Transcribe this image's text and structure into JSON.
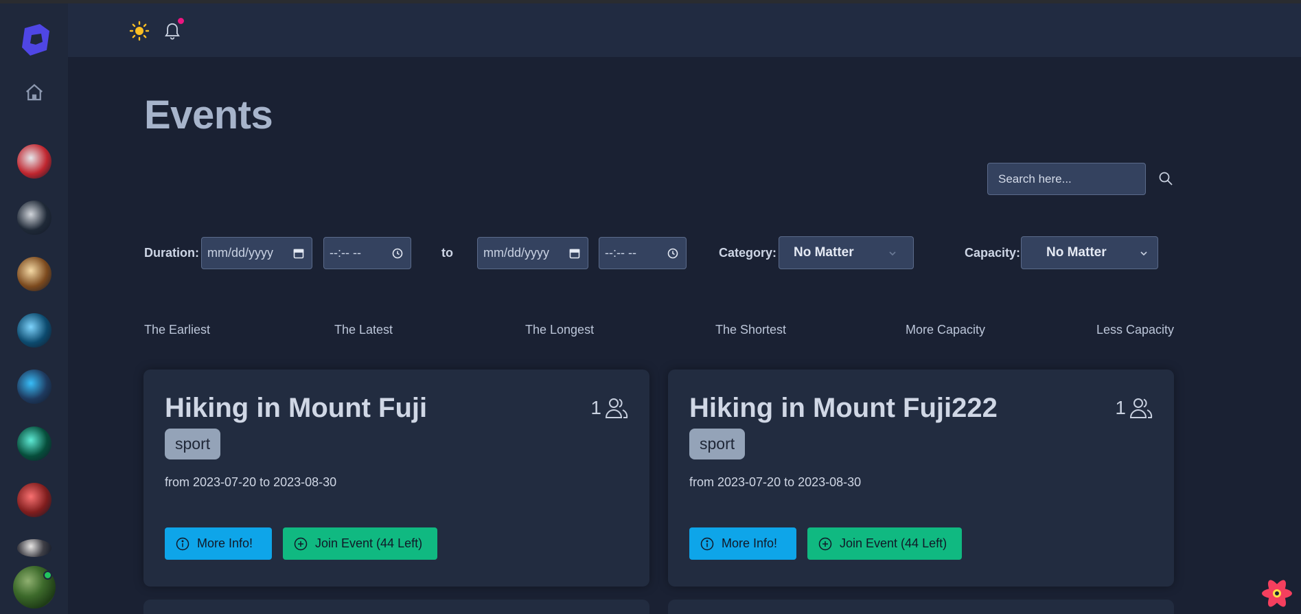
{
  "header": {
    "theme_icon": "sun-icon",
    "notification_icon": "bell-icon",
    "notification_color": "#ec1680"
  },
  "sidebar": {
    "logo_color": "#4f46e5",
    "home_icon": "home-icon",
    "avatars": [
      {
        "name": "avatar-1",
        "colors": [
          "#c0262f",
          "#e5e7eb"
        ]
      },
      {
        "name": "avatar-2",
        "colors": [
          "#1f2937",
          "#d1d5db"
        ]
      },
      {
        "name": "avatar-3",
        "colors": [
          "#7c4a1e",
          "#f4d9a5"
        ]
      },
      {
        "name": "avatar-4",
        "colors": [
          "#0c4a6e",
          "#7dd3fc"
        ]
      },
      {
        "name": "avatar-5",
        "colors": [
          "#1e3a5f",
          "#38bdf8"
        ]
      },
      {
        "name": "avatar-6",
        "colors": [
          "#064e3b",
          "#5eead4"
        ]
      },
      {
        "name": "avatar-7",
        "colors": [
          "#7f1d1d",
          "#f87171"
        ]
      },
      {
        "name": "avatar-8",
        "colors": [
          "#3f3f46",
          "#e7e5e4"
        ]
      }
    ],
    "user_status_color": "#22c55e"
  },
  "page": {
    "title": "Events"
  },
  "search": {
    "placeholder": "Search here..."
  },
  "filters": {
    "duration_label": "Duration:",
    "date_placeholder": "mm/dd/yyyy",
    "time_placeholder": "--:-- --",
    "to_label": "to",
    "category_label": "Category:",
    "category_value": "No Matter",
    "capacity_label": "Capacity:",
    "capacity_value": "No Matter"
  },
  "sort_options": [
    "The Earliest",
    "The Latest",
    "The Longest",
    "The Shortest",
    "More Capacity",
    "Less Capacity"
  ],
  "events": [
    {
      "title": "Hiking in Mount Fuji",
      "participants": "1",
      "tag": "sport",
      "dates": "from 2023-07-20 to 2023-08-30",
      "info_label": "More Info!",
      "join_label": "Join Event (44 Left)"
    },
    {
      "title": "Hiking in Mount Fuji222",
      "participants": "1",
      "tag": "sport",
      "dates": "from 2023-07-20 to 2023-08-30",
      "info_label": "More Info!",
      "join_label": "Join Event (44 Left)"
    }
  ],
  "colors": {
    "background": "#1a2133",
    "card": "#222c40",
    "info_button": "#0ea5e9",
    "join_button": "#10b981",
    "tag": "#94a3b8"
  }
}
